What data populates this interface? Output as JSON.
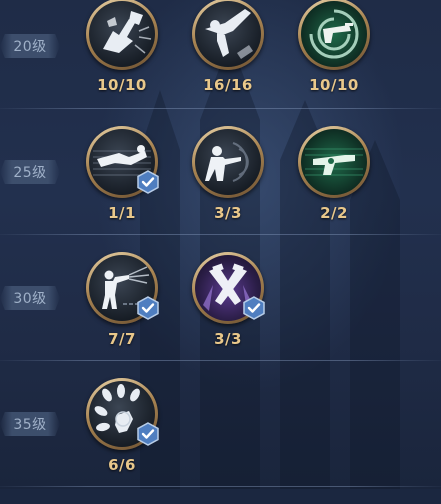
{
  "tiers": [
    {
      "level": "20级",
      "skills": [
        {
          "icon": "shattering-strike-icon",
          "count": "10/10",
          "checked": false
        },
        {
          "icon": "high-kick-icon",
          "count": "16/16",
          "checked": false
        },
        {
          "icon": "revolver-swirl-icon",
          "count": "10/10",
          "checked": false
        }
      ]
    },
    {
      "level": "25级",
      "skills": [
        {
          "icon": "dash-slash-icon",
          "count": "1/1",
          "checked": true
        },
        {
          "icon": "gunshot-pose-icon",
          "count": "3/3",
          "checked": false
        },
        {
          "icon": "green-revolver-icon",
          "count": "2/2",
          "checked": false
        }
      ]
    },
    {
      "level": "30级",
      "skills": [
        {
          "icon": "rapid-fire-icon",
          "count": "7/7",
          "checked": true
        },
        {
          "icon": "crossed-pistols-icon",
          "count": "3/3",
          "checked": true
        }
      ]
    },
    {
      "level": "35级",
      "skills": [
        {
          "icon": "bullet-barrage-icon",
          "count": "6/6",
          "checked": true
        }
      ]
    }
  ],
  "colors": {
    "count_text": "#e9c88b",
    "level_text": "#9fb0c8",
    "check_badge": "#4f7ec0",
    "ring_gold": "#c9a56e"
  }
}
